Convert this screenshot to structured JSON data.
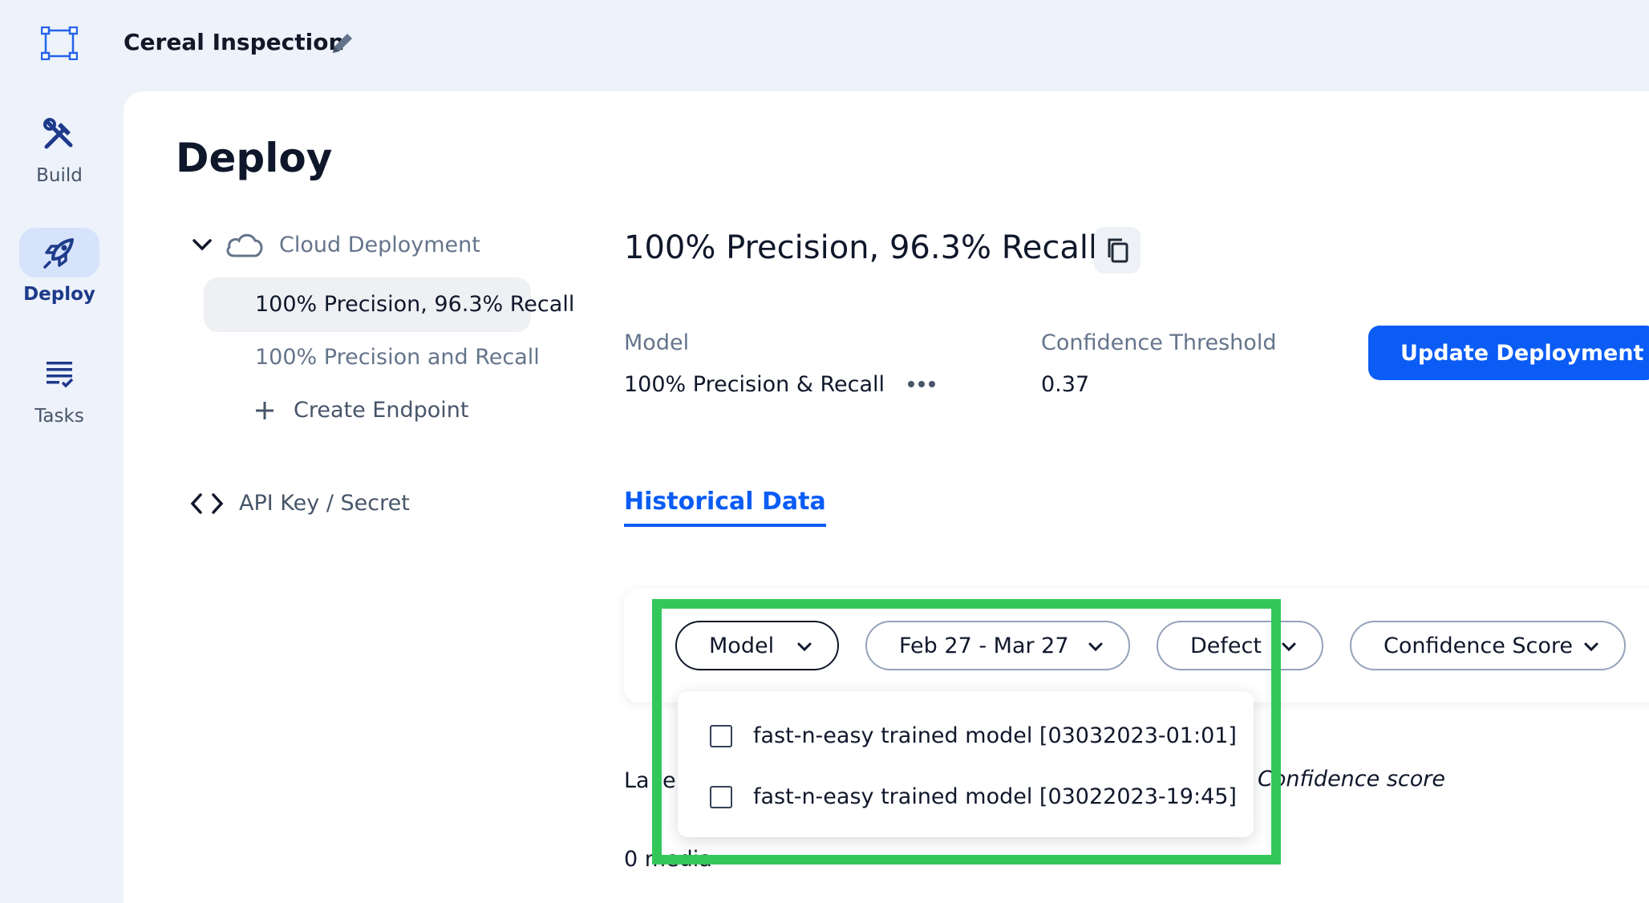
{
  "header": {
    "project_name": "Cereal Inspection"
  },
  "rail": {
    "items": [
      {
        "label": "Build",
        "icon": "build-tools-icon"
      },
      {
        "label": "Deploy",
        "icon": "rocket-icon",
        "active": true
      },
      {
        "label": "Tasks",
        "icon": "tasks-list-icon"
      }
    ]
  },
  "page": {
    "title": "Deploy"
  },
  "nav": {
    "group_label": "Cloud Deployment",
    "endpoints": [
      "100% Precision, 96.3% Recall",
      "100% Precision and Recall"
    ],
    "create_label": "Create Endpoint",
    "api_label": "API Key / Secret"
  },
  "endpoint": {
    "title": "100% Precision, 96.3% Recall",
    "model_label": "Model",
    "model_value": "100% Precision & Recall",
    "threshold_label": "Confidence Threshold",
    "threshold_value": "0.37",
    "update_label": "Update Deployment"
  },
  "tabs": {
    "historical": "Historical Data"
  },
  "filters": {
    "model": "Model",
    "date": "Feb 27 - Mar 27",
    "defect": "Defect",
    "confidence": "Confidence Score"
  },
  "background": {
    "label_fragment_a": "La",
    "label_fragment_b": "e",
    "confidence_fragment": "Confidence score",
    "count_fragment": "0 media"
  },
  "dropdown": {
    "options": [
      "fast-n-easy trained model [03032023-01:01]",
      "fast-n-easy trained model [03022023-19:45]"
    ]
  },
  "colors": {
    "accent": "#0a5cf5",
    "highlight": "#33c75a",
    "rail_active": "#d7e3fb"
  }
}
